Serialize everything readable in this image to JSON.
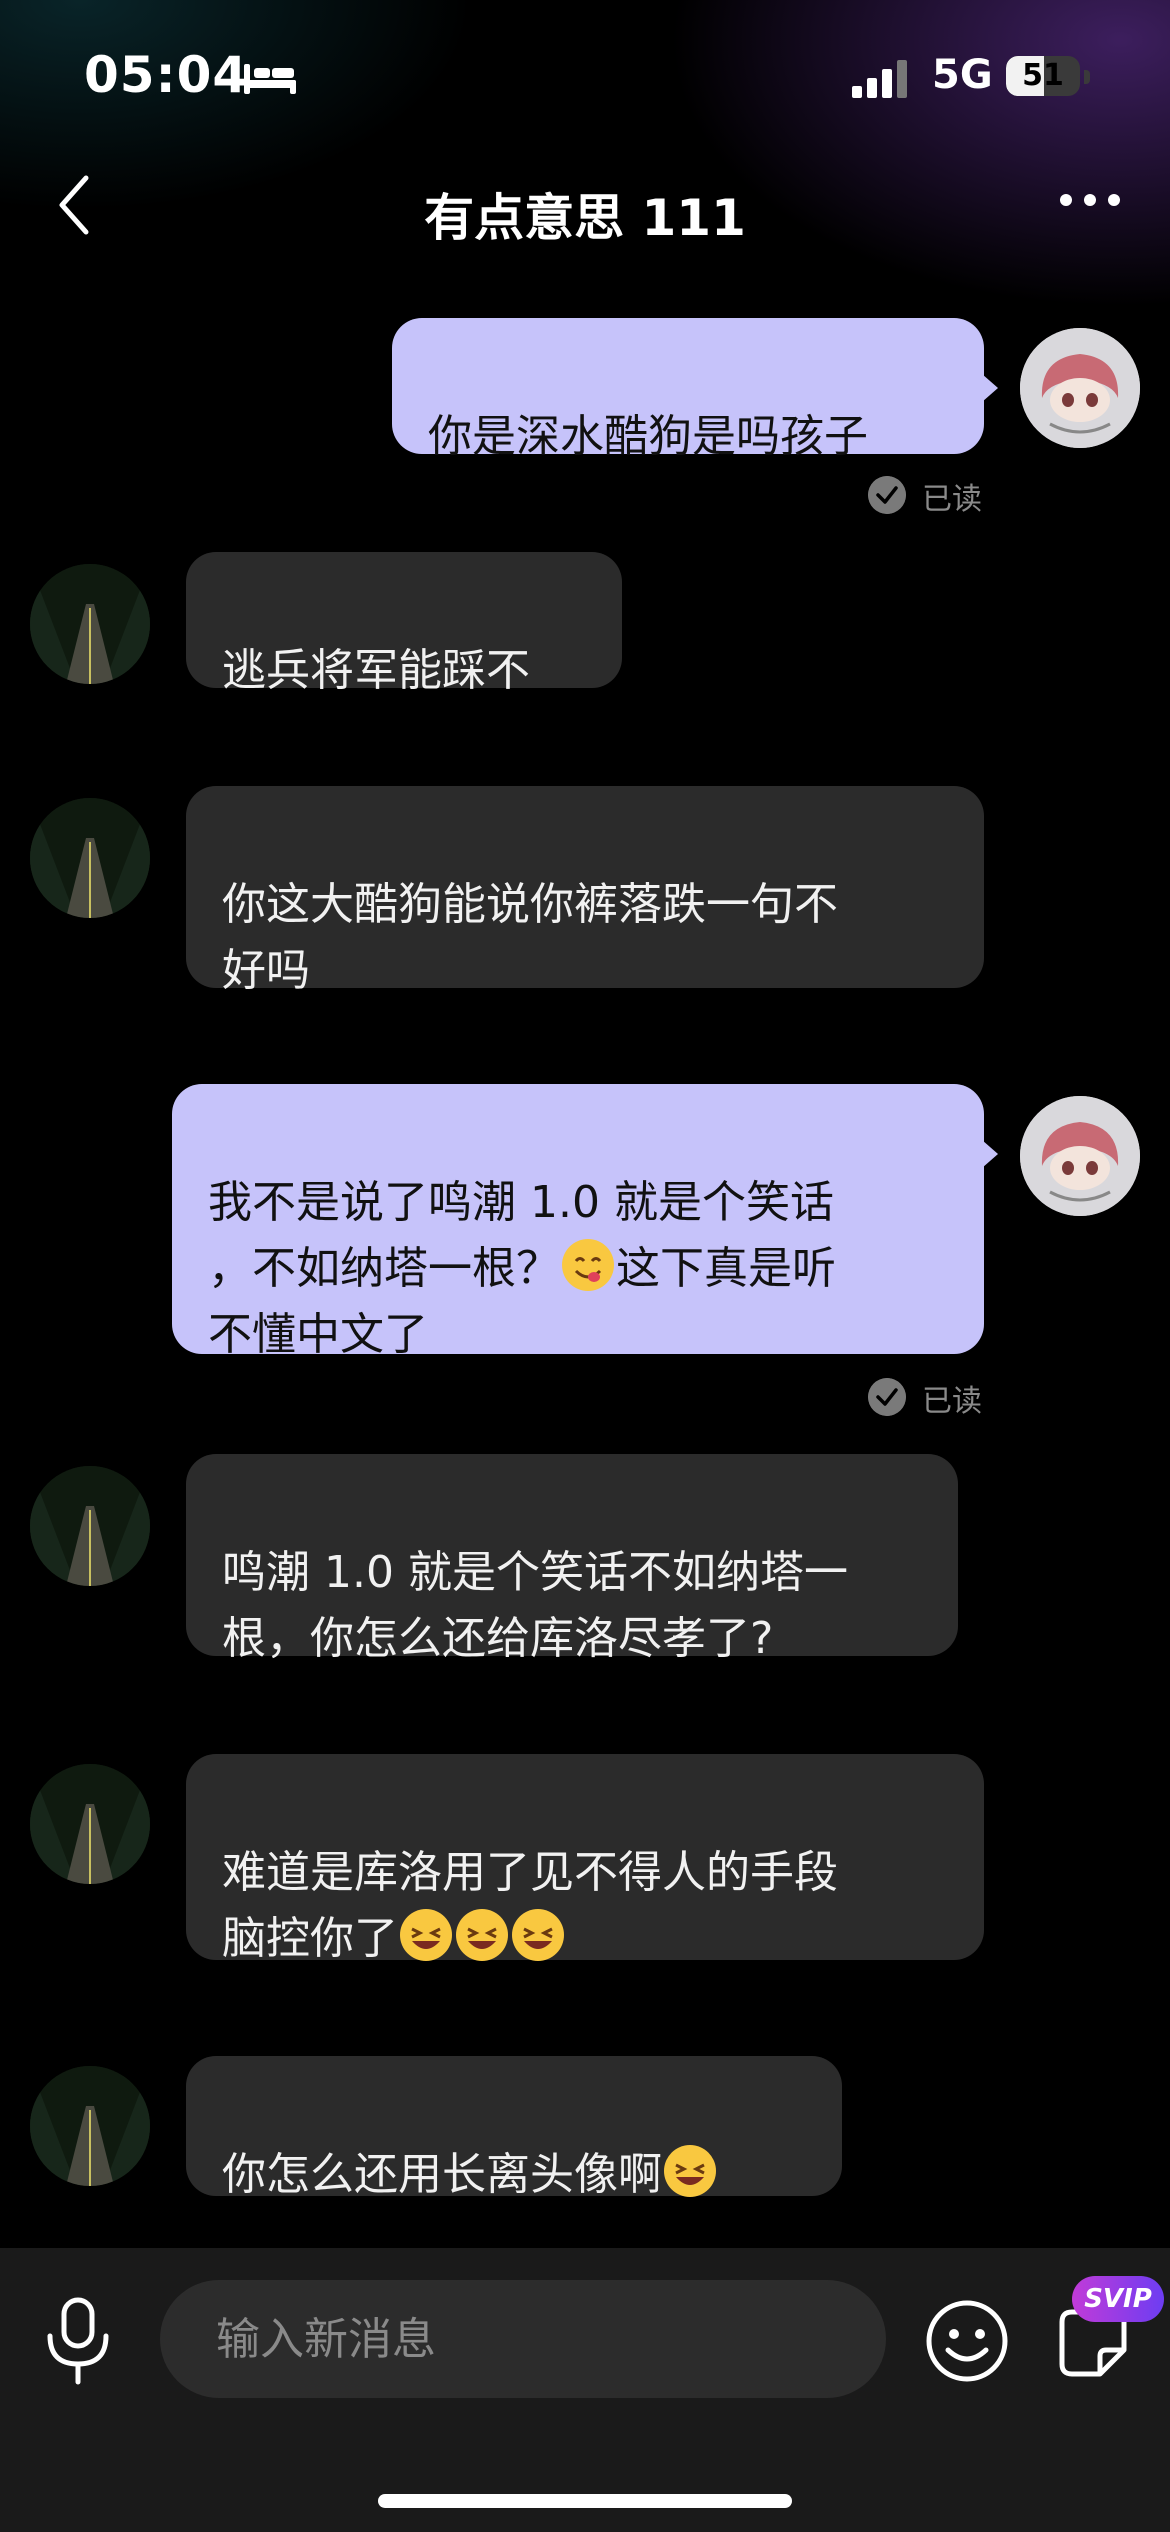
{
  "status_bar": {
    "time": "05:04",
    "network": "5G",
    "battery_level": "51",
    "battery_percent": 51
  },
  "header": {
    "title": "有点意思 111"
  },
  "messages": [
    {
      "side": "out",
      "text": "你是深水酷狗是吗孩子",
      "read_label": "已读"
    },
    {
      "side": "in",
      "text": "逃兵将军能踩不"
    },
    {
      "side": "in",
      "text": "你这大酷狗能说你裤落跌一句不\n好吗"
    },
    {
      "side": "out",
      "text_a": "我不是说了鸣潮 1.0 就是个笑话\n，不如纳塔一根？",
      "emoji": "😋",
      "text_b": "这下真是听\n不懂中文了",
      "read_label": "已读"
    },
    {
      "side": "in",
      "text": "鸣潮 1.0 就是个笑话不如纳塔一\n根，你怎么还给库洛尽孝了?"
    },
    {
      "side": "in",
      "text": "难道是库洛用了见不得人的手段\n脑控你了",
      "emojis": [
        "😆",
        "😆",
        "😆"
      ]
    },
    {
      "side": "in",
      "text": "你怎么还用长离头像啊",
      "emoji": "😆"
    }
  ],
  "composer": {
    "placeholder": "输入新消息",
    "badge": "SVIP"
  },
  "icons": [
    "bed-icon",
    "signal-icon",
    "battery-icon",
    "back-icon",
    "more-icon",
    "check-icon",
    "microphone-icon",
    "emoji-icon",
    "sticker-icon"
  ]
}
